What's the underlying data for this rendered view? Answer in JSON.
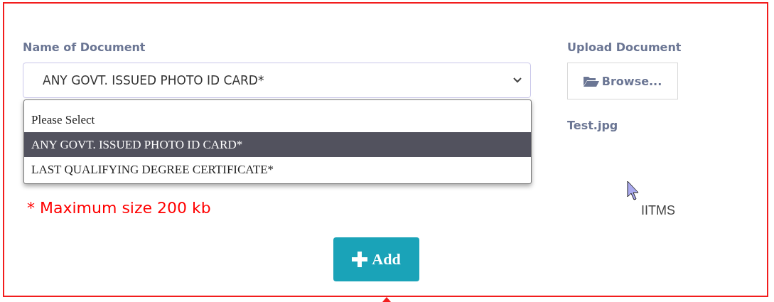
{
  "form": {
    "name_label": "Name of Document",
    "select": {
      "value": "ANY GOVT. ISSUED PHOTO ID CARD*",
      "expanded": true,
      "options": [
        {
          "label": "Please Select",
          "selected": false
        },
        {
          "label": "ANY GOVT. ISSUED PHOTO ID CARD*",
          "selected": true
        },
        {
          "label": "LAST QUALIFYING DEGREE CERTIFICATE*",
          "selected": false
        }
      ]
    },
    "hints": [
      "* Maximum size 200 kb"
    ],
    "upload_label": "Upload Document",
    "browse_button": "Browse...",
    "file_name": "Test.jpg",
    "add_button": "Add"
  },
  "footer_text": "IITMS"
}
